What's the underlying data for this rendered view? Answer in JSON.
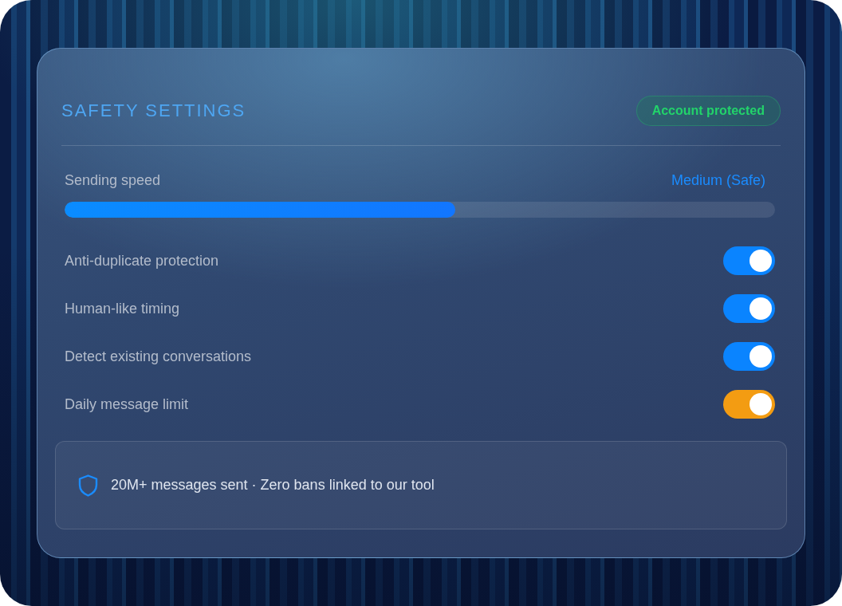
{
  "panel": {
    "title": "SAFETY SETTINGS",
    "status_badge": "Account protected",
    "speed": {
      "label": "Sending speed",
      "reading": "Medium (Safe)",
      "level": 0.55
    },
    "options": [
      {
        "label": "Anti-duplicate protection",
        "on": true,
        "color": "#0a84ff"
      },
      {
        "label": "Human-like timing",
        "on": true,
        "color": "#0a84ff"
      },
      {
        "label": "Detect existing conversations",
        "on": true,
        "color": "#0a84ff"
      },
      {
        "label": "Daily message limit",
        "on": true,
        "color": "#f39c12"
      }
    ],
    "footer": {
      "text": "20M+ messages sent · Zero bans linked to our tool"
    }
  }
}
